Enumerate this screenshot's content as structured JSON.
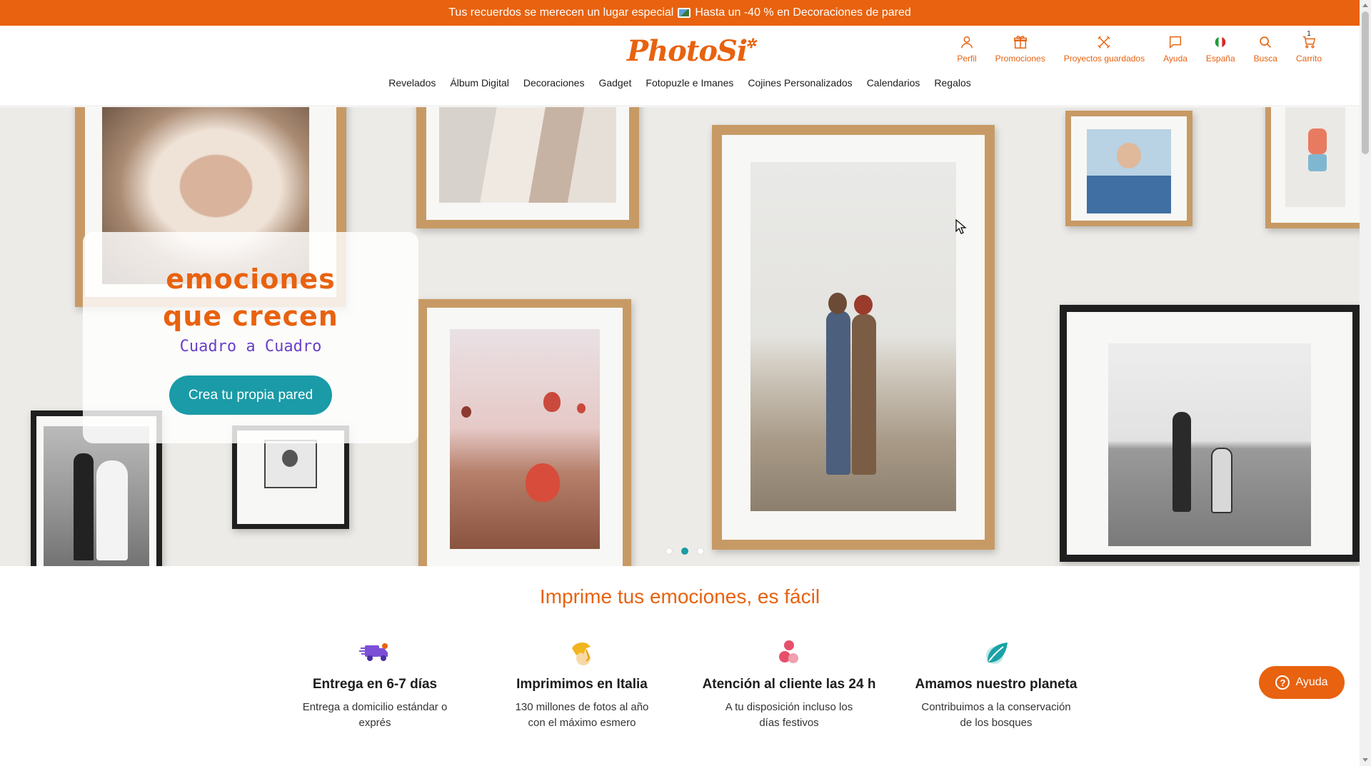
{
  "promo_bar": {
    "text_before": "Tus recuerdos se merecen un lugar especial",
    "text_after": "Hasta un -40 % en Decoraciones de pared"
  },
  "logo": {
    "text": "PhotoSi"
  },
  "header_tools": [
    {
      "label": "Perfil",
      "icon": "user-icon"
    },
    {
      "label": "Promociones",
      "icon": "gift-icon"
    },
    {
      "label": "Proyectos guardados",
      "icon": "tools-icon"
    },
    {
      "label": "Ayuda",
      "icon": "chat-icon"
    },
    {
      "label": "España",
      "icon": "flag-icon"
    },
    {
      "label": "Busca",
      "icon": "search-icon"
    },
    {
      "label": "Carrito",
      "icon": "cart-icon",
      "count": "1"
    }
  ],
  "nav": [
    "Revelados",
    "Álbum Digital",
    "Decoraciones",
    "Gadget",
    "Fotopuzle e Imanes",
    "Cojines Personalizados",
    "Calendarios",
    "Regalos"
  ],
  "hero": {
    "title_line1": "emociones",
    "title_line2": "que crecen",
    "subtitle": "Cuadro a Cuadro",
    "cta": "Crea tu propia pared",
    "slides": 3,
    "active_slide": 2
  },
  "section_title": "Imprime tus emociones, es fácil",
  "features": [
    {
      "title": "Entrega en 6-7 días",
      "text": "Entrega a domicilio estándar o exprés",
      "icon": "truck-icon"
    },
    {
      "title": "Imprimimos en Italia",
      "text": "130 millones de fotos al año con el máximo esmero",
      "icon": "italy-icon"
    },
    {
      "title": "Atención al cliente las 24 h",
      "text": "A tu disposición incluso los días festivos",
      "icon": "support-icon"
    },
    {
      "title": "Amamos nuestro planeta",
      "text": "Contribuimos a la conservación de los bosques",
      "icon": "leaf-icon"
    }
  ],
  "help_button": {
    "label": "Ayuda"
  },
  "colors": {
    "brand": "#e8620f",
    "teal": "#1a9ba7",
    "purple": "#6a3fc9"
  }
}
